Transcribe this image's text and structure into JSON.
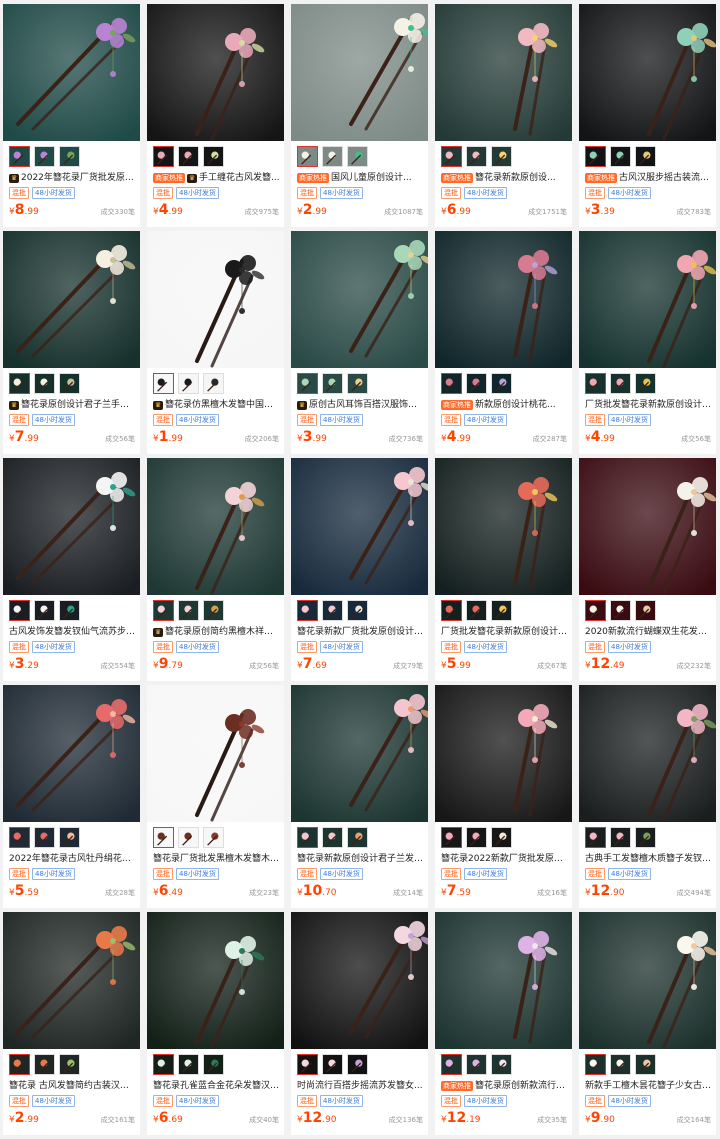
{
  "labels": {
    "mix": "混批",
    "ship": "48小时发货",
    "hot": "商家热推",
    "currency": "¥"
  },
  "products": [
    {
      "title": "2022年簪花录厂货批发原创...",
      "crown": true,
      "hot": false,
      "price_int": "8",
      "price_dec": ".99",
      "sold": "成交330笔",
      "palette": [
        "#1f4a47",
        "#b983d4",
        "#7aa35a"
      ]
    },
    {
      "title": "手工缠花古风发簪...",
      "crown": true,
      "hot": true,
      "price_int": "4",
      "price_dec": ".99",
      "sold": "成交975笔",
      "palette": [
        "#151515",
        "#e8a9b8",
        "#cfe0a3"
      ]
    },
    {
      "title": "国风儿童原创设计...",
      "crown": false,
      "hot": true,
      "price_int": "2",
      "price_dec": ".99",
      "sold": "成交1087笔",
      "palette": [
        "#7d8a86",
        "#f4f1e6",
        "#3fbf8a"
      ]
    },
    {
      "title": "簪花录新款原创设...",
      "crown": false,
      "hot": true,
      "price_int": "6",
      "price_dec": ".99",
      "sold": "成交1751笔",
      "palette": [
        "#243a36",
        "#f3b9c3",
        "#f6d36b"
      ]
    },
    {
      "title": "古风汉服步摇古装流苏...",
      "crown": false,
      "hot": true,
      "price_int": "3",
      "price_dec": ".39",
      "sold": "成交783笔",
      "palette": [
        "#121416",
        "#8fd0b8",
        "#e8c67a"
      ]
    },
    {
      "title": "簪花录原创设计君子兰手工...",
      "crown": true,
      "hot": false,
      "price_int": "7",
      "price_dec": ".99",
      "sold": "成交56笔",
      "palette": [
        "#16302c",
        "#f4efe0",
        "#c8c09a"
      ]
    },
    {
      "title": "簪花录仿黑檀木发簪中国风...",
      "crown": true,
      "hot": false,
      "price_int": "1",
      "price_dec": ".99",
      "sold": "成交206笔",
      "palette": [
        "#f6f6f6",
        "#1a1a1a",
        "#2a2a2a"
      ]
    },
    {
      "title": "原创古风耳饰百搭汉服饰品...",
      "crown": true,
      "hot": false,
      "price_int": "3",
      "price_dec": ".99",
      "sold": "成交736笔",
      "palette": [
        "#2a4a46",
        "#a8d8b8",
        "#e8d090"
      ]
    },
    {
      "title": "新款原创设计桃花...",
      "crown": false,
      "hot": true,
      "price_int": "4",
      "price_dec": ".99",
      "sold": "成交287笔",
      "palette": [
        "#10262a",
        "#d87a90",
        "#b7a3e0"
      ]
    },
    {
      "title": "厂货批发簪花录新款原创设计发...",
      "crown": false,
      "hot": false,
      "price_int": "4",
      "price_dec": ".99",
      "sold": "成交56笔",
      "palette": [
        "#15322e",
        "#f2a6b4",
        "#e9c34a"
      ]
    },
    {
      "title": "古风发饰发簪发钗仙气流苏步摇...",
      "crown": false,
      "hot": false,
      "price_int": "3",
      "price_dec": ".29",
      "sold": "成交554笔",
      "palette": [
        "#1a1e22",
        "#f4f4f4",
        "#2aa38a"
      ]
    },
    {
      "title": "簪花录原创简约黑檀木祥云...",
      "crown": true,
      "hot": false,
      "price_int": "9",
      "price_dec": ".79",
      "sold": "成交56笔",
      "palette": [
        "#1e3834",
        "#f3d3d8",
        "#d9a04a"
      ]
    },
    {
      "title": "簪花录新款厂货批发原创设计发...",
      "crown": false,
      "hot": false,
      "price_int": "7",
      "price_dec": ".69",
      "sold": "成交79笔",
      "palette": [
        "#172a3c",
        "#f5c8d0",
        "#e8e6d6"
      ]
    },
    {
      "title": "厂货批发簪花录新款原创设计铃...",
      "crown": false,
      "hot": false,
      "price_int": "5",
      "price_dec": ".99",
      "sold": "成交67笔",
      "palette": [
        "#14201f",
        "#e66a5a",
        "#f0c95a"
      ]
    },
    {
      "title": "2020新款流行蝴蝶双生花发簪...",
      "crown": false,
      "hot": false,
      "price_int": "12",
      "price_dec": ".49",
      "sold": "成交232笔",
      "palette": [
        "#3a0c12",
        "#f6f2ea",
        "#e7c9a0"
      ]
    },
    {
      "title": "2022年簪花录古风牡丹绢花汉...",
      "crown": false,
      "hot": false,
      "price_int": "5",
      "price_dec": ".59",
      "sold": "成交28笔",
      "palette": [
        "#1f2a34",
        "#e56b6b",
        "#f2b8a0"
      ]
    },
    {
      "title": "簪花录厂货批发黑檀木发簪木簪...",
      "crown": false,
      "hot": false,
      "price_int": "6",
      "price_dec": ".49",
      "sold": "成交23笔",
      "palette": [
        "#f7f7f7",
        "#6b2e22",
        "#8a3a2a"
      ]
    },
    {
      "title": "簪花录新款原创设计君子兰发簪...",
      "crown": false,
      "hot": false,
      "price_int": "10",
      "price_dec": ".70",
      "sold": "成交14笔",
      "palette": [
        "#1c3531",
        "#f5c5cf",
        "#e9a070"
      ]
    },
    {
      "title": "簪花录2022新款厂货批发原创...",
      "crown": false,
      "hot": false,
      "price_int": "7",
      "price_dec": ".59",
      "sold": "成交16笔",
      "palette": [
        "#171717",
        "#f3a9b8",
        "#f2ebd2"
      ]
    },
    {
      "title": "古典手工发簪檀木质簪子发钗古装...",
      "crown": false,
      "hot": false,
      "price_int": "12",
      "price_dec": ".90",
      "sold": "成交494笔",
      "palette": [
        "#1a1e1e",
        "#f2b6c4",
        "#7aa060"
      ]
    },
    {
      "title": "簪花录 古风发簪简约古装汉服...",
      "crown": false,
      "hot": false,
      "price_int": "2",
      "price_dec": ".99",
      "sold": "成交161笔",
      "palette": [
        "#1f2624",
        "#e87a4a",
        "#9bbf6a"
      ]
    },
    {
      "title": "簪花录孔雀蓝合金花朵发簪汉服...",
      "crown": false,
      "hot": false,
      "price_int": "6",
      "price_dec": ".69",
      "sold": "成交40笔",
      "palette": [
        "#122018",
        "#dff2e8",
        "#2a7a5a"
      ]
    },
    {
      "title": "时尚流行百搭步摇流苏发簪女...",
      "crown": false,
      "hot": false,
      "price_int": "12",
      "price_dec": ".90",
      "sold": "成交136笔",
      "palette": [
        "#121212",
        "#f4d7df",
        "#c6a0d6"
      ]
    },
    {
      "title": "簪花录原创新款流行桃...",
      "crown": false,
      "hot": true,
      "price_int": "12",
      "price_dec": ".19",
      "sold": "成交35笔",
      "palette": [
        "#1d3430",
        "#dfb2e6",
        "#f1e6ee"
      ]
    },
    {
      "title": "新款手工檀木昙花簪子少女古风...",
      "crown": false,
      "hot": false,
      "price_int": "9",
      "price_dec": ".90",
      "sold": "成交164笔",
      "palette": [
        "#1c302c",
        "#fbf7ee",
        "#f0c7a0"
      ]
    }
  ]
}
